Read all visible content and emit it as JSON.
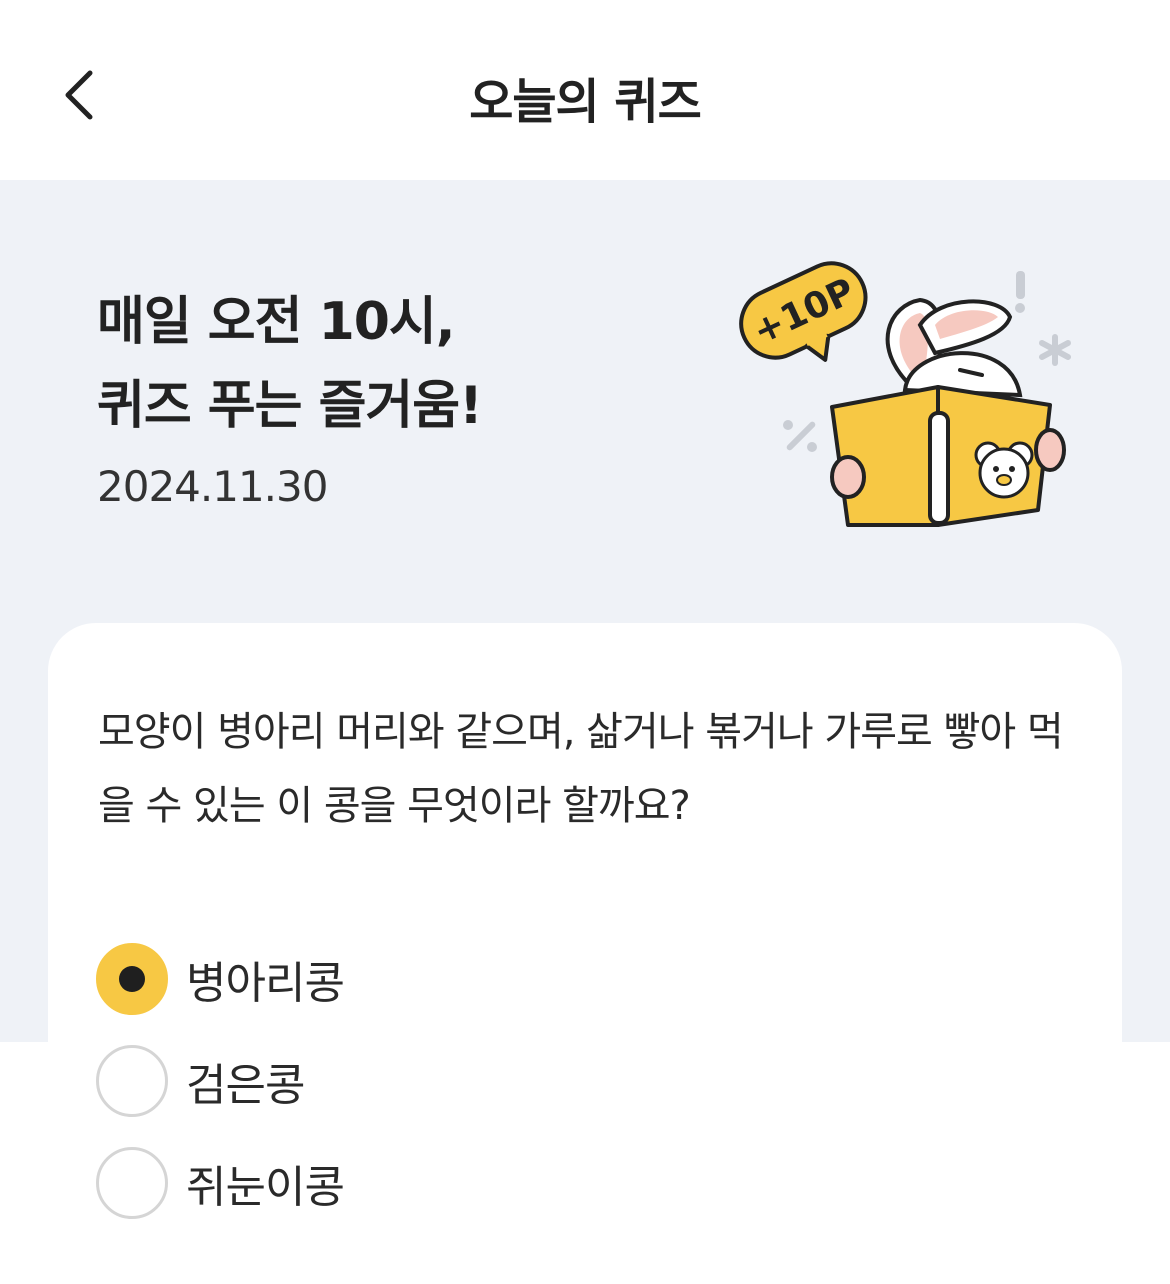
{
  "header": {
    "back_icon": "chevron-left-icon",
    "title": "오늘의 퀴즈"
  },
  "hero": {
    "title_line1": "매일 오전 10시,",
    "title_line2": "퀴즈 푸는 즐거움!",
    "date": "2024.11.30",
    "badge": "+10P",
    "illustration": "rabbit-reading-book-icon"
  },
  "quiz": {
    "question": "모양이 병아리 머리와 같으며, 삶거나 볶거나 가루로 빻아 먹을 수 있는 이 콩을 무엇이라 할까요?",
    "options": [
      {
        "label": "병아리콩",
        "selected": true
      },
      {
        "label": "검은콩",
        "selected": false
      },
      {
        "label": "쥐눈이콩",
        "selected": false
      }
    ]
  },
  "colors": {
    "accent_yellow": "#f7c844",
    "hero_background": "#eff2f7",
    "text": "#222222"
  }
}
